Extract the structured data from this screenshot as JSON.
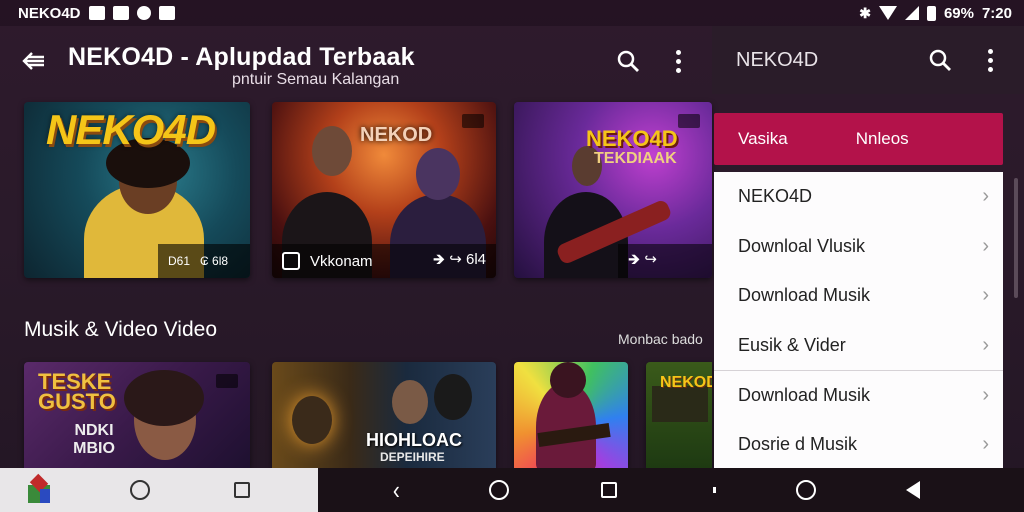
{
  "status_bar": {
    "app_name": "NEKO4D",
    "battery": "69%",
    "time": "7:20"
  },
  "app_bar": {
    "title": "NEKO4D - Aplupdad Terbaak",
    "subtitle": "pntuir Semau Kalangan"
  },
  "featured_cards": [
    {
      "label": "NEKO4D",
      "footer_text": "D61",
      "footer_extra": "₢ 6l8",
      "accent": "#f5c518"
    },
    {
      "label": "NEKOD",
      "footer_text": "Vkkonam",
      "footer_extra": "🡺 ↪ 6l4"
    },
    {
      "label": "NEKO4D",
      "sub_label": "TEKDIAAK",
      "footer_extra": "🡺 ↪"
    }
  ],
  "section": {
    "title": "Musik & Video Video",
    "more_link": "Monbac bado"
  },
  "bottom_cards": [
    {
      "label": "TESKE GUSTO",
      "sub_label": "NDKI MBIO"
    },
    {
      "label": "HIOHLOAC",
      "sub_label": "DEPEIHIRE"
    },
    {
      "label": ""
    },
    {
      "label": "NEKOD"
    }
  ],
  "drawer": {
    "title": "NEKO4D",
    "tabs": [
      "Vasika",
      "Nnleos"
    ],
    "items": [
      {
        "label": "NEKO4D"
      },
      {
        "label": "Downloal Vlusik"
      },
      {
        "label": "Download Musik"
      },
      {
        "label": "Eusik & Vider"
      },
      {
        "label": "Download Musik"
      },
      {
        "label": "Dosrie d Musik"
      }
    ]
  },
  "colors": {
    "accent": "#b3124a",
    "background": "#2a1a2a",
    "drawer_bg": "#fdfcfd"
  }
}
